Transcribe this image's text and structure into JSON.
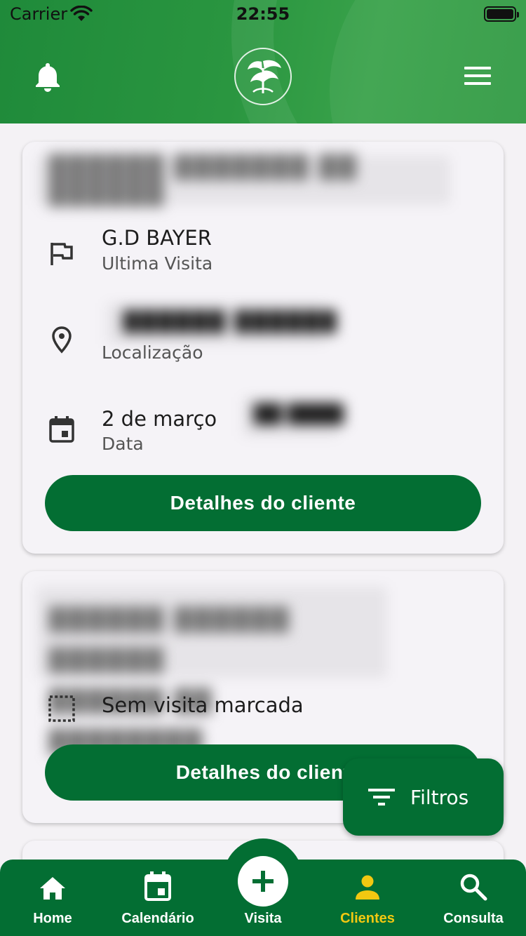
{
  "status_bar": {
    "carrier": "Carrier",
    "time": "22:55"
  },
  "cards": [
    {
      "title_redacted": "██████ ███████ ██ ██████",
      "last_visit": {
        "value": "G.D BAYER",
        "label": "Ultima Visita"
      },
      "location": {
        "value_redacted": "██████ ██████",
        "label": "Localização"
      },
      "date": {
        "value": "2 de março",
        "value_redacted_suffix": "██ ████",
        "label": "Data"
      },
      "details_button": "Detalhes do cliente"
    },
    {
      "title_redacted_line1": "██████ ██████ ██████",
      "title_redacted_line2": "██████ ██ ████████",
      "no_visit_text": "Sem visita marcada",
      "details_button": "Detalhes do client"
    }
  ],
  "fab": {
    "label": "Filtros"
  },
  "bottom_nav": {
    "items": [
      {
        "label": "Home",
        "icon": "home-icon"
      },
      {
        "label": "Calendário",
        "icon": "calendar-icon"
      },
      {
        "label": "Visita",
        "icon": "plus-icon"
      },
      {
        "label": "Clientes",
        "icon": "person-icon",
        "active": true
      },
      {
        "label": "Consulta",
        "icon": "search-icon"
      }
    ]
  },
  "colors": {
    "primary": "#036e33",
    "header": "#2a9640",
    "active_nav": "#f2c811",
    "background": "#f4f2f5"
  }
}
